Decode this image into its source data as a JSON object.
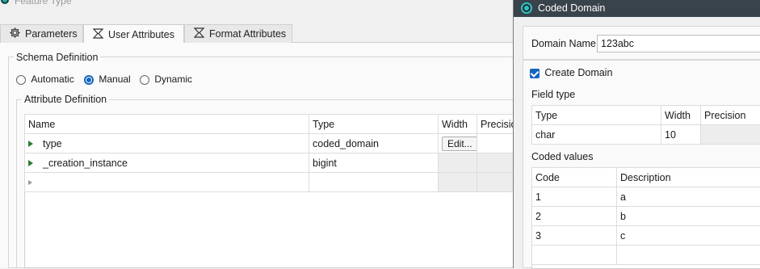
{
  "background_window": {
    "title": "Feature Type",
    "tabs": [
      {
        "label": "Parameters",
        "icon": "gear-icon"
      },
      {
        "label": "User Attributes",
        "icon": "sigma-icon"
      },
      {
        "label": "Format Attributes",
        "icon": "sigma-icon"
      }
    ],
    "schema_definition": {
      "label": "Schema Definition",
      "options": [
        "Automatic",
        "Manual",
        "Dynamic"
      ],
      "selected": "Manual"
    },
    "attribute_definition": {
      "label": "Attribute Definition",
      "columns": [
        "Name",
        "Type",
        "Width",
        "Precision"
      ],
      "rows": [
        {
          "name": "type",
          "type": "coded_domain",
          "width_button": "Edit..."
        },
        {
          "name": "_creation_instance",
          "type": "bigint"
        }
      ]
    }
  },
  "dialog": {
    "title": "Coded Domain",
    "domain_name_label": "Domain Name",
    "domain_name_value": "123abc",
    "create_domain_label": "Create Domain",
    "create_domain_checked": true,
    "field_type": {
      "label": "Field type",
      "columns": [
        "Type",
        "Width",
        "Precision"
      ],
      "row": {
        "type": "char",
        "width": "10",
        "precision": ""
      }
    },
    "coded_values": {
      "label": "Coded values",
      "columns": [
        "Code",
        "Description"
      ],
      "rows": [
        {
          "code": "1",
          "description": "a"
        },
        {
          "code": "2",
          "description": "b"
        },
        {
          "code": "3",
          "description": "c"
        }
      ]
    }
  },
  "colors": {
    "accent": "#1565c0",
    "dialog_titlebar": "#39434c",
    "row_arrow": "#2e7d32"
  }
}
